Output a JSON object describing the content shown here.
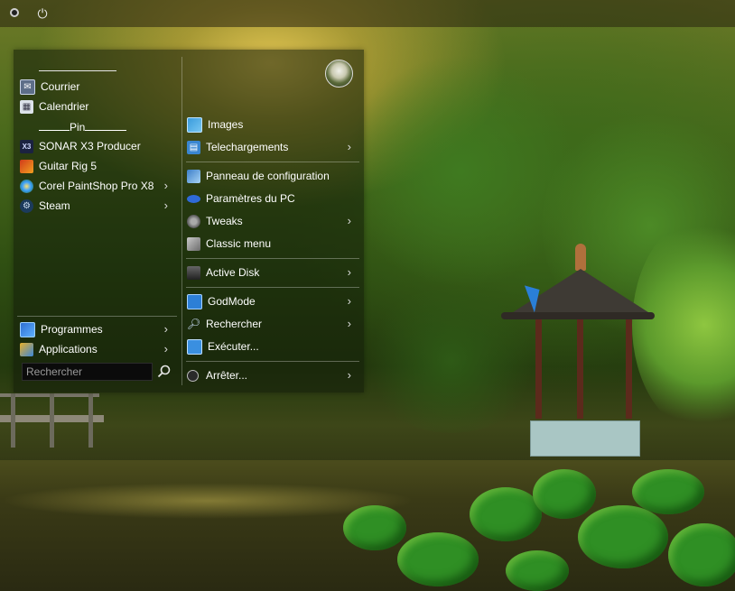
{
  "taskbar": {
    "start_icon": "start-orb-icon",
    "power_icon": "power-icon",
    "power_glyph": "⏻"
  },
  "start_menu": {
    "left": {
      "top_separator": "______________",
      "pinned": [
        {
          "label": "Courrier",
          "icon": "mail-icon",
          "has_submenu": false
        },
        {
          "label": "Calendrier",
          "icon": "calendar-icon",
          "has_submenu": false
        }
      ],
      "pin_heading": "Pin",
      "programs": [
        {
          "label": "SONAR X3 Producer",
          "icon": "sonar-x3-icon",
          "icon_text": "X3",
          "has_submenu": false
        },
        {
          "label": "Guitar Rig 5",
          "icon": "guitar-rig-icon",
          "has_submenu": false
        },
        {
          "label": "Corel PaintShop Pro X8",
          "icon": "corel-paintshop-icon",
          "has_submenu": true
        },
        {
          "label": "Steam",
          "icon": "steam-icon",
          "has_submenu": true
        }
      ],
      "bottom": [
        {
          "label": "Programmes",
          "icon": "programs-icon",
          "has_submenu": true
        },
        {
          "label": "Applications",
          "icon": "applications-icon",
          "has_submenu": true
        }
      ],
      "search": {
        "placeholder": "Rechercher",
        "value": ""
      }
    },
    "right": {
      "groups": [
        [
          {
            "label": "Images",
            "icon": "images-icon",
            "has_submenu": false
          },
          {
            "label": "Telechargements",
            "icon": "downloads-icon",
            "has_submenu": true
          }
        ],
        [
          {
            "label": "Panneau de configuration",
            "icon": "control-panel-icon",
            "has_submenu": false
          },
          {
            "label": "Paramètres du PC",
            "icon": "pc-settings-icon",
            "has_submenu": false
          },
          {
            "label": "Tweaks",
            "icon": "tweaks-gear-icon",
            "has_submenu": true
          },
          {
            "label": "Classic menu",
            "icon": "classic-menu-icon",
            "has_submenu": false
          }
        ],
        [
          {
            "label": "Active Disk",
            "icon": "disk-drive-icon",
            "has_submenu": true
          }
        ],
        [
          {
            "label": "GodMode",
            "icon": "godmode-icon",
            "has_submenu": true
          },
          {
            "label": "Rechercher",
            "icon": "search-icon",
            "has_submenu": true
          },
          {
            "label": "Exécuter...",
            "icon": "run-icon",
            "has_submenu": false
          }
        ],
        [
          {
            "label": "Arrêter...",
            "icon": "shutdown-icon",
            "has_submenu": true
          }
        ]
      ]
    },
    "avatar_icon": "user-avatar",
    "chevron_glyph": "›"
  },
  "colors": {
    "menu_bg": "#121c0a",
    "text": "#ffffff",
    "separator": "#e6e6e6"
  }
}
